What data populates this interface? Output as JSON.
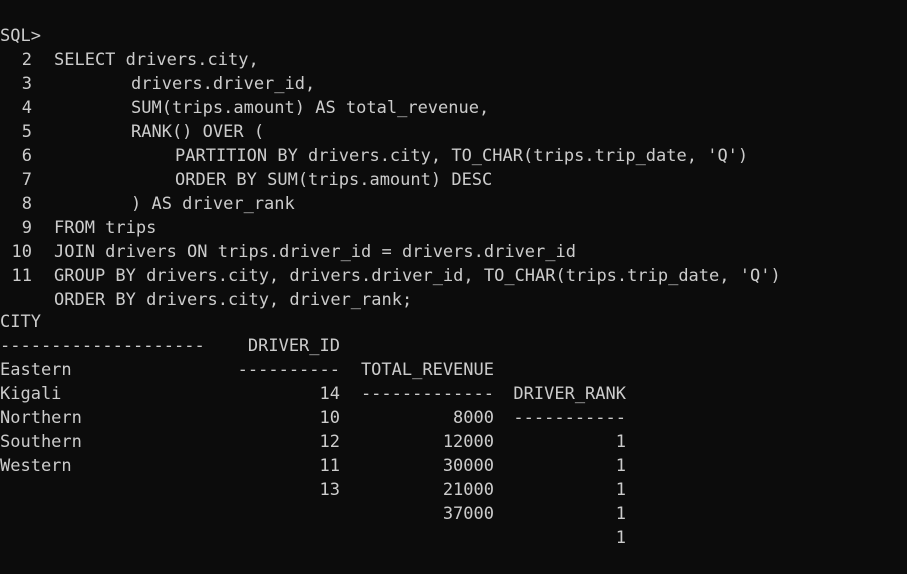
{
  "terminal": {
    "prompt": "SQL>",
    "query_lines": [
      {
        "num": "",
        "text": "SELECT drivers.city,",
        "indent": 0
      },
      {
        "num": "2",
        "text": "drivers.driver_id,",
        "indent": 1
      },
      {
        "num": "3",
        "text": "SUM(trips.amount) AS total_revenue,",
        "indent": 1
      },
      {
        "num": "4",
        "text": "RANK() OVER (",
        "indent": 1
      },
      {
        "num": "5",
        "text": "PARTITION BY drivers.city, TO_CHAR(trips.trip_date, 'Q')",
        "indent": 2
      },
      {
        "num": "6",
        "text": "ORDER BY SUM(trips.amount) DESC",
        "indent": 2
      },
      {
        "num": "7",
        "text": ") AS driver_rank",
        "indent": 1
      },
      {
        "num": "8",
        "text": "FROM trips",
        "indent": 0
      },
      {
        "num": "9",
        "text": "JOIN drivers ON trips.driver_id = drivers.driver_id",
        "indent": 0
      },
      {
        "num": "10",
        "text": "GROUP BY drivers.city, drivers.driver_id, TO_CHAR(trips.trip_date, 'Q')",
        "indent": 0
      },
      {
        "num": "11",
        "text": "ORDER BY drivers.city, driver_rank;",
        "indent": 0
      }
    ],
    "result": {
      "headers": [
        "CITY",
        "DRIVER_ID",
        "TOTAL_REVENUE",
        "DRIVER_RANK"
      ],
      "dividers": [
        "--------------------",
        "----------",
        "-------------",
        "-----------"
      ],
      "rows": [
        [
          "Eastern",
          "14",
          "8000",
          "1"
        ],
        [
          "Kigali",
          "10",
          "12000",
          "1"
        ],
        [
          "Northern",
          "12",
          "30000",
          "1"
        ],
        [
          "Southern",
          "11",
          "21000",
          "1"
        ],
        [
          "Western",
          "13",
          "37000",
          "1"
        ]
      ]
    },
    "colors": {
      "background": "#0c0c0c",
      "text": "#cccccc"
    }
  }
}
